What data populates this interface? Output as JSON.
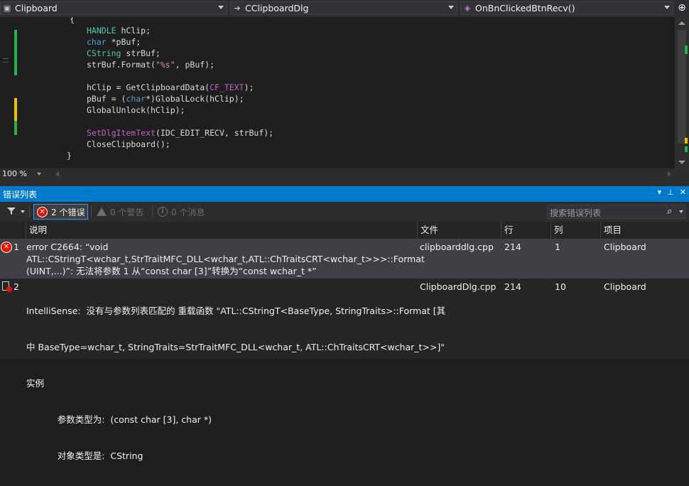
{
  "nav": {
    "project": "Clipboard",
    "class": "CClipboardDlg",
    "member": "OnBnClickedBtnRecv()"
  },
  "code_lines": [
    [
      [
        "{",
        ""
      ]
    ],
    [
      [
        "HANDLE",
        "ty"
      ],
      [
        " hClip;",
        ""
      ]
    ],
    [
      [
        "char",
        "kw"
      ],
      [
        " *pBuf;",
        ""
      ]
    ],
    [
      [
        "CString",
        "ty"
      ],
      [
        " strBuf;",
        ""
      ]
    ],
    [
      [
        "strBuf.Format(",
        ""
      ],
      [
        "\"%s\"",
        "str"
      ],
      [
        ", pBuf);",
        ""
      ]
    ],
    [
      [
        "",
        ""
      ]
    ],
    [
      [
        "hClip = GetClipboardData(",
        ""
      ],
      [
        "CF_TEXT",
        "mac"
      ],
      [
        ");",
        ""
      ]
    ],
    [
      [
        "pBuf = (",
        ""
      ],
      [
        "char",
        "kw"
      ],
      [
        "*)GlobalLock(hClip);",
        ""
      ]
    ],
    [
      [
        "GlobalUnlock(hClip);",
        ""
      ]
    ],
    [
      [
        "",
        ""
      ]
    ],
    [
      [
        "SetDlgItemText",
        "mac"
      ],
      [
        "(IDC_EDIT_RECV, strBuf);",
        ""
      ]
    ],
    [
      [
        "CloseClipboard();",
        ""
      ]
    ],
    [
      [
        "}",
        ""
      ]
    ]
  ],
  "editor": {
    "zoom": "100 %"
  },
  "error_list": {
    "title": "错误列表",
    "errors_btn": "2 个错误",
    "warnings_btn": "0 个警告",
    "messages_btn": "0 个消息",
    "search_placeholder": "搜索错误列表",
    "columns": {
      "num": "",
      "desc": "说明",
      "file": "文件",
      "line": "行",
      "col": "列",
      "project": "项目"
    },
    "rows": [
      {
        "num": "1",
        "icon": "error-icon",
        "desc": [
          "error C2664: “void",
          "ATL::CStringT<wchar_t,StrTraitMFC_DLL<wchar_t,ATL::ChTraitsCRT<wchar_t>>>::Format",
          "(UINT,...)”: 无法将参数 1 从“const char [3]”转换为“const wchar_t *”"
        ],
        "file": "clipboarddlg.cpp",
        "line": "214",
        "col": "1",
        "project": "Clipboard"
      },
      {
        "num": "2",
        "icon": "intellisense-error-icon",
        "desc": [
          "IntelliSense:  没有与参数列表匹配的 重载函数 \"ATL::CStringT<BaseType, StringTraits>::Format [其",
          "中 BaseType=wchar_t, StringTraits=StrTraitMFC_DLL<wchar_t, ATL::ChTraitsCRT<wchar_t>>]\"",
          "实例",
          "           参数类型为:  (const char [3], char *)",
          "           对象类型是:  CString"
        ],
        "file": "ClipboardDlg.cpp",
        "line": "214",
        "col": "10",
        "project": "Clipboard"
      }
    ]
  },
  "colors": {
    "panel_title_bg": "#007acc",
    "error_red": "#e51400",
    "marker_green": "#23b14d",
    "marker_yellow": "#e5c300"
  }
}
